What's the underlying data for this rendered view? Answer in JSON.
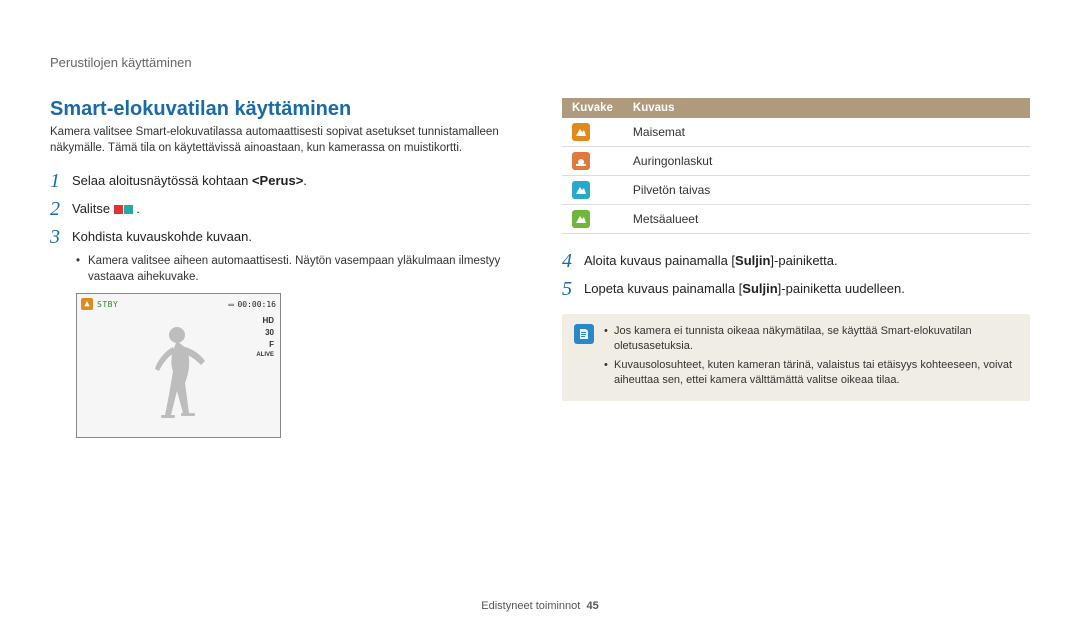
{
  "header_crumb": "Perustilojen käyttäminen",
  "title": "Smart-elokuvatilan käyttäminen",
  "intro": "Kamera valitsee Smart-elokuvatilassa automaattisesti sopivat asetukset tunnistamalleen näkymälle. Tämä tila on käytettävissä ainoastaan, kun kamerassa on muistikortti.",
  "steps": {
    "s1_pre": "Selaa aloitusnäytössä kohtaan ",
    "s1_bold": "<Perus>",
    "s1_post": ".",
    "s2": "Valitse ",
    "s2_post": " .",
    "s3": "Kohdista kuvauskohde kuvaan.",
    "s3_sub": "Kamera valitsee aiheen automaattisesti. Näytön vasempaan yläkulmaan ilmestyy vastaava aihekuvake.",
    "s4_pre": "Aloita kuvaus painamalla [",
    "s4_bold": "Suljin",
    "s4_post": "]-painiketta.",
    "s5_pre": "Lopeta kuvaus painamalla [",
    "s5_bold": "Suljin",
    "s5_post": "]-painiketta uudelleen."
  },
  "preview": {
    "stby": "STBY",
    "time": "00:00:16",
    "hd": "HD",
    "fps": "30",
    "f": "F",
    "alive": "ALIVE"
  },
  "icon_table": {
    "head_icon": "Kuvake",
    "head_desc": "Kuvaus",
    "rows": [
      {
        "label": "Maisemat",
        "color": "ic-orange",
        "glyph": "mountain"
      },
      {
        "label": "Auringonlaskut",
        "color": "ic-orange2",
        "glyph": "sunset"
      },
      {
        "label": "Pilvetön taivas",
        "color": "ic-blue",
        "glyph": "mountain"
      },
      {
        "label": "Metsäalueet",
        "color": "ic-green",
        "glyph": "mountain"
      }
    ]
  },
  "notes": {
    "n1": "Jos kamera ei tunnista oikeaa näkymätilaa, se käyttää Smart-elokuvatilan oletusasetuksia.",
    "n2": "Kuvausolosuhteet, kuten kameran tärinä, valaistus tai etäisyys kohteeseen, voivat aiheuttaa sen, ettei kamera välttämättä valitse oikeaa tilaa."
  },
  "footer_label": "Edistyneet toiminnot",
  "page_number": "45"
}
